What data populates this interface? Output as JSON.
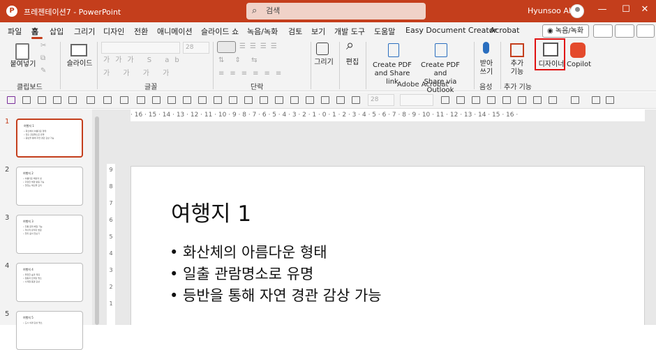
{
  "titlebar": {
    "doc_title": "프레젠테이션7  -  PowerPoint",
    "search_placeholder": "검색",
    "user_name": "Hyunsoo Ahn",
    "minimize": "—",
    "restore": "☐",
    "close": "✕"
  },
  "menu": {
    "tabs": [
      "파일",
      "홈",
      "삽입",
      "그리기",
      "디자인",
      "전환",
      "애니메이션",
      "슬라이드 쇼",
      "녹음/녹화",
      "검토",
      "보기",
      "개발 도구",
      "도움말",
      "Easy Document Creator",
      "Acrobat"
    ],
    "active_tab": "홈",
    "record_button": "◉ 녹음/녹화"
  },
  "ribbon": {
    "paste": "붙여넣기",
    "clipboard_group": "클립보드",
    "slides": "슬라이드",
    "font_group": "글꼴",
    "font_size": "28",
    "paragraph_group": "단락",
    "drawing": "그리기",
    "editing": "편집",
    "create_pdf_share": "Create PDF\nand Share link",
    "create_pdf_outlook": "Create PDF and\nShare via Outlook",
    "adobe_group": "Adobe Acrobat",
    "dictate": "받아\n쓰기",
    "voice_group": "음성",
    "addins": "추가\n기능",
    "addins_group": "추가 기능",
    "designer": "디자이너",
    "copilot": "Copilot"
  },
  "qat": {
    "font_size": "28"
  },
  "ruler": {
    "horizontal": "· 16 · 15 · 14 · 13 · 12 · 11 · 10 · 9 · 8 · 7 · 6 · 5 · 4 · 3 · 2 · 1 · 0 · 1 · 2 · 3 · 4 · 5 · 6 · 7 · 8 · 9 · 10 · 11 · 12 · 13 · 14 · 15 · 16 ·",
    "vertical": [
      "9",
      "8",
      "7",
      "6",
      "5",
      "4",
      "3",
      "2",
      "1"
    ]
  },
  "thumbnails": [
    {
      "num": "1",
      "title": "여행지 1",
      "lines": [
        "• 화산체의 아름다운 형태",
        "• 일출 관람명소로 유명",
        "• 등반을 통해 자연 경관 감상 가능"
      ]
    },
    {
      "num": "2",
      "title": "여행지 2",
      "lines": [
        "• 아름다운 해변과 섬",
        "• 다양한 해양 활동 가능",
        "• 맛있는 해산물 요리"
      ]
    },
    {
      "num": "3",
      "title": "여행지 3",
      "lines": [
        "• 전통 문화 체험 가능",
        "• 역사적 유적지 방문",
        "• 현지 음식 맛보기"
      ]
    },
    {
      "num": "4",
      "title": "여행지 4",
      "lines": [
        "• 울창한 숲과 계곡",
        "• 캠핑과 트레킹 명소",
        "• 사계절 풍경 감상"
      ]
    },
    {
      "num": "5",
      "title": "여행지 5",
      "lines": [
        "• 도시 야경 감상 명소"
      ]
    }
  ],
  "slide": {
    "title": "여행지 1",
    "bullets": [
      "• 화산체의 아름다운 형태",
      "• 일출 관람명소로 유명",
      "• 등반을 통해 자연 경관 감상 가능"
    ]
  },
  "colors": {
    "accent": "#c43e1c",
    "highlight_box": "#e01010"
  }
}
